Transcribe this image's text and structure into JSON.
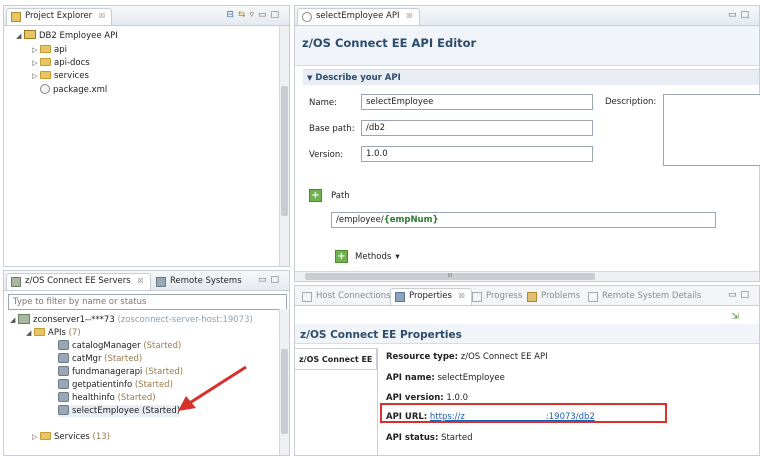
{
  "project_explorer": {
    "title": "Project Explorer",
    "close": "☒",
    "tree": [
      {
        "label": "DB2 Employee API",
        "depth": 0,
        "expanded": true
      },
      {
        "label": "api",
        "depth": 1
      },
      {
        "label": "api-docs",
        "depth": 1
      },
      {
        "label": "services",
        "depth": 1
      },
      {
        "label": "package.xml",
        "depth": 1
      }
    ]
  },
  "editor": {
    "tab_title": "selectEmployee API",
    "close": "☒",
    "heading": "z/OS Connect EE API Editor",
    "section": "Describe your API",
    "name_label": "Name:",
    "name_value": "selectEmployee",
    "base_path_label": "Base path:",
    "base_path_value": "/db2",
    "version_label": "Version:",
    "version_value": "1.0.0",
    "description_label": "Description:",
    "path_label": "Path",
    "path_value_plain": "/employee/",
    "path_value_param": "{empNum}",
    "methods_label": "Methods",
    "scroll_mark": "III"
  },
  "servers": {
    "tabs": [
      "z/OS Connect EE Servers",
      "Remote Systems"
    ],
    "close": "☒",
    "filter_placeholder": "Type to filter by name or status",
    "server_label": "zconserver1--***73",
    "server_suffix": "(zosconnect-server-host:19073)",
    "apis_label": "APIs",
    "apis_count": "(7)",
    "apis": [
      {
        "name": "catalogManager",
        "status": "(Started)"
      },
      {
        "name": "catMgr",
        "status": "(Started)"
      },
      {
        "name": "fundmanagerapi",
        "status": "(Started)"
      },
      {
        "name": "getpatientinfo",
        "status": "(Started)"
      },
      {
        "name": "healthinfo",
        "status": "(Started)"
      },
      {
        "name": "selectEmployee",
        "status": "(Started)"
      }
    ],
    "services_label": "Services",
    "services_count": "(13)"
  },
  "bottom_tabs": [
    {
      "label": "Host Connections",
      "active": false
    },
    {
      "label": "Properties",
      "active": true
    },
    {
      "label": "Progress",
      "active": false
    },
    {
      "label": "Problems",
      "active": false
    },
    {
      "label": "Remote System Details",
      "active": false
    }
  ],
  "properties": {
    "close": "☒",
    "heading": "z/OS Connect EE Properties",
    "side_tab": "z/OS Connect EE",
    "resource_type_label": "Resource type:",
    "resource_type_value": "z/OS Connect EE API",
    "api_name_label": "API name:",
    "api_name_value": "selectEmployee",
    "api_version_label": "API version:",
    "api_version_value": "1.0.0",
    "api_url_label": "API URL:",
    "api_url_value": "https://z                              :19073/db2",
    "api_status_label": "API status:",
    "api_status_value": "Started"
  },
  "colors": {
    "highlight_box": "#d8302a",
    "arrow": "#d8302a",
    "heading": "#2b4b6f"
  }
}
